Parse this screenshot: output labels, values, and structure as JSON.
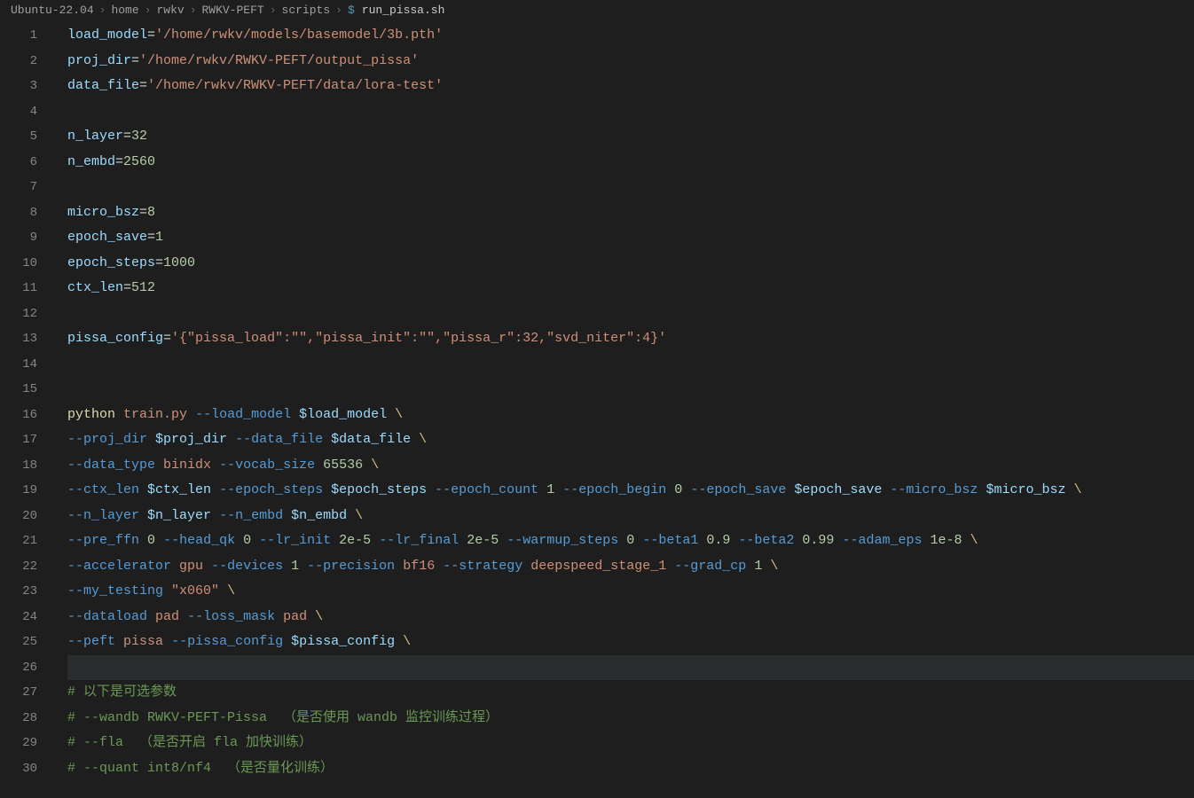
{
  "breadcrumb": {
    "items": [
      "Ubuntu-22.04",
      "home",
      "rwkv",
      "RWKV-PEFT",
      "scripts"
    ],
    "icon": "$",
    "file": "run_pissa.sh"
  },
  "code": {
    "lines": [
      {
        "n": 1,
        "tokens": [
          {
            "c": "var",
            "t": "load_model"
          },
          {
            "c": "op",
            "t": "="
          },
          {
            "c": "str",
            "t": "'/home/rwkv/models/basemodel/3b.pth'"
          }
        ]
      },
      {
        "n": 2,
        "tokens": [
          {
            "c": "var",
            "t": "proj_dir"
          },
          {
            "c": "op",
            "t": "="
          },
          {
            "c": "str",
            "t": "'/home/rwkv/RWKV-PEFT/output_pissa'"
          }
        ]
      },
      {
        "n": 3,
        "tokens": [
          {
            "c": "var",
            "t": "data_file"
          },
          {
            "c": "op",
            "t": "="
          },
          {
            "c": "str",
            "t": "'/home/rwkv/RWKV-PEFT/data/lora-test'"
          }
        ]
      },
      {
        "n": 4,
        "tokens": []
      },
      {
        "n": 5,
        "tokens": [
          {
            "c": "var",
            "t": "n_layer"
          },
          {
            "c": "op",
            "t": "="
          },
          {
            "c": "num-lit",
            "t": "32"
          }
        ]
      },
      {
        "n": 6,
        "tokens": [
          {
            "c": "var",
            "t": "n_embd"
          },
          {
            "c": "op",
            "t": "="
          },
          {
            "c": "num-lit",
            "t": "2560"
          }
        ]
      },
      {
        "n": 7,
        "tokens": []
      },
      {
        "n": 8,
        "tokens": [
          {
            "c": "var",
            "t": "micro_bsz"
          },
          {
            "c": "op",
            "t": "="
          },
          {
            "c": "num-lit",
            "t": "8"
          }
        ]
      },
      {
        "n": 9,
        "tokens": [
          {
            "c": "var",
            "t": "epoch_save"
          },
          {
            "c": "op",
            "t": "="
          },
          {
            "c": "num-lit",
            "t": "1"
          }
        ]
      },
      {
        "n": 10,
        "tokens": [
          {
            "c": "var",
            "t": "epoch_steps"
          },
          {
            "c": "op",
            "t": "="
          },
          {
            "c": "num-lit",
            "t": "1000"
          }
        ]
      },
      {
        "n": 11,
        "tokens": [
          {
            "c": "var",
            "t": "ctx_len"
          },
          {
            "c": "op",
            "t": "="
          },
          {
            "c": "num-lit",
            "t": "512"
          }
        ]
      },
      {
        "n": 12,
        "tokens": []
      },
      {
        "n": 13,
        "tokens": [
          {
            "c": "var",
            "t": "pissa_config"
          },
          {
            "c": "op",
            "t": "="
          },
          {
            "c": "str",
            "t": "'{\"pissa_load\":\"\",\"pissa_init\":\"\",\"pissa_r\":32,\"svd_niter\":4}'"
          }
        ]
      },
      {
        "n": 14,
        "tokens": []
      },
      {
        "n": 15,
        "tokens": []
      },
      {
        "n": 16,
        "tokens": [
          {
            "c": "cmd",
            "t": "python"
          },
          {
            "c": "op",
            "t": " "
          },
          {
            "c": "arg",
            "t": "train.py"
          },
          {
            "c": "op",
            "t": " "
          },
          {
            "c": "flag",
            "t": "--load_model"
          },
          {
            "c": "op",
            "t": " "
          },
          {
            "c": "dollar",
            "t": "$load_model"
          },
          {
            "c": "op",
            "t": " "
          },
          {
            "c": "esc",
            "t": "\\"
          }
        ]
      },
      {
        "n": 17,
        "tokens": [
          {
            "c": "flag",
            "t": "--proj_dir"
          },
          {
            "c": "op",
            "t": " "
          },
          {
            "c": "dollar",
            "t": "$proj_dir"
          },
          {
            "c": "op",
            "t": " "
          },
          {
            "c": "flag",
            "t": "--data_file"
          },
          {
            "c": "op",
            "t": " "
          },
          {
            "c": "dollar",
            "t": "$data_file"
          },
          {
            "c": "op",
            "t": " "
          },
          {
            "c": "esc",
            "t": "\\"
          }
        ]
      },
      {
        "n": 18,
        "tokens": [
          {
            "c": "flag",
            "t": "--data_type"
          },
          {
            "c": "op",
            "t": " "
          },
          {
            "c": "arg",
            "t": "binidx"
          },
          {
            "c": "op",
            "t": " "
          },
          {
            "c": "flag",
            "t": "--vocab_size"
          },
          {
            "c": "op",
            "t": " "
          },
          {
            "c": "num-lit",
            "t": "65536"
          },
          {
            "c": "op",
            "t": " "
          },
          {
            "c": "esc",
            "t": "\\"
          }
        ]
      },
      {
        "n": 19,
        "tokens": [
          {
            "c": "flag",
            "t": "--ctx_len"
          },
          {
            "c": "op",
            "t": " "
          },
          {
            "c": "dollar",
            "t": "$ctx_len"
          },
          {
            "c": "op",
            "t": " "
          },
          {
            "c": "flag",
            "t": "--epoch_steps"
          },
          {
            "c": "op",
            "t": " "
          },
          {
            "c": "dollar",
            "t": "$epoch_steps"
          },
          {
            "c": "op",
            "t": " "
          },
          {
            "c": "flag",
            "t": "--epoch_count"
          },
          {
            "c": "op",
            "t": " "
          },
          {
            "c": "num-lit",
            "t": "1"
          },
          {
            "c": "op",
            "t": " "
          },
          {
            "c": "flag",
            "t": "--epoch_begin"
          },
          {
            "c": "op",
            "t": " "
          },
          {
            "c": "num-lit",
            "t": "0"
          },
          {
            "c": "op",
            "t": " "
          },
          {
            "c": "flag",
            "t": "--epoch_save"
          },
          {
            "c": "op",
            "t": " "
          },
          {
            "c": "dollar",
            "t": "$epoch_save"
          },
          {
            "c": "op",
            "t": " "
          },
          {
            "c": "flag",
            "t": "--micro_bsz"
          },
          {
            "c": "op",
            "t": " "
          },
          {
            "c": "dollar",
            "t": "$micro_bsz"
          },
          {
            "c": "op",
            "t": " "
          },
          {
            "c": "esc",
            "t": "\\"
          }
        ]
      },
      {
        "n": 20,
        "tokens": [
          {
            "c": "flag",
            "t": "--n_layer"
          },
          {
            "c": "op",
            "t": " "
          },
          {
            "c": "dollar",
            "t": "$n_layer"
          },
          {
            "c": "op",
            "t": " "
          },
          {
            "c": "flag",
            "t": "--n_embd"
          },
          {
            "c": "op",
            "t": " "
          },
          {
            "c": "dollar",
            "t": "$n_embd"
          },
          {
            "c": "op",
            "t": " "
          },
          {
            "c": "esc",
            "t": "\\"
          }
        ]
      },
      {
        "n": 21,
        "tokens": [
          {
            "c": "flag",
            "t": "--pre_ffn"
          },
          {
            "c": "op",
            "t": " "
          },
          {
            "c": "num-lit",
            "t": "0"
          },
          {
            "c": "op",
            "t": " "
          },
          {
            "c": "flag",
            "t": "--head_qk"
          },
          {
            "c": "op",
            "t": " "
          },
          {
            "c": "num-lit",
            "t": "0"
          },
          {
            "c": "op",
            "t": " "
          },
          {
            "c": "flag",
            "t": "--lr_init"
          },
          {
            "c": "op",
            "t": " "
          },
          {
            "c": "num-lit",
            "t": "2e-5"
          },
          {
            "c": "op",
            "t": " "
          },
          {
            "c": "flag",
            "t": "--lr_final"
          },
          {
            "c": "op",
            "t": " "
          },
          {
            "c": "num-lit",
            "t": "2e-5"
          },
          {
            "c": "op",
            "t": " "
          },
          {
            "c": "flag",
            "t": "--warmup_steps"
          },
          {
            "c": "op",
            "t": " "
          },
          {
            "c": "num-lit",
            "t": "0"
          },
          {
            "c": "op",
            "t": " "
          },
          {
            "c": "flag",
            "t": "--beta1"
          },
          {
            "c": "op",
            "t": " "
          },
          {
            "c": "num-lit",
            "t": "0.9"
          },
          {
            "c": "op",
            "t": " "
          },
          {
            "c": "flag",
            "t": "--beta2"
          },
          {
            "c": "op",
            "t": " "
          },
          {
            "c": "num-lit",
            "t": "0.99"
          },
          {
            "c": "op",
            "t": " "
          },
          {
            "c": "flag",
            "t": "--adam_eps"
          },
          {
            "c": "op",
            "t": " "
          },
          {
            "c": "num-lit",
            "t": "1e-8"
          },
          {
            "c": "op",
            "t": " "
          },
          {
            "c": "esc",
            "t": "\\"
          }
        ]
      },
      {
        "n": 22,
        "tokens": [
          {
            "c": "flag",
            "t": "--accelerator"
          },
          {
            "c": "op",
            "t": " "
          },
          {
            "c": "arg",
            "t": "gpu"
          },
          {
            "c": "op",
            "t": " "
          },
          {
            "c": "flag",
            "t": "--devices"
          },
          {
            "c": "op",
            "t": " "
          },
          {
            "c": "num-lit",
            "t": "1"
          },
          {
            "c": "op",
            "t": " "
          },
          {
            "c": "flag",
            "t": "--precision"
          },
          {
            "c": "op",
            "t": " "
          },
          {
            "c": "arg",
            "t": "bf16"
          },
          {
            "c": "op",
            "t": " "
          },
          {
            "c": "flag",
            "t": "--strategy"
          },
          {
            "c": "op",
            "t": " "
          },
          {
            "c": "arg",
            "t": "deepspeed_stage_1"
          },
          {
            "c": "op",
            "t": " "
          },
          {
            "c": "flag",
            "t": "--grad_cp"
          },
          {
            "c": "op",
            "t": " "
          },
          {
            "c": "num-lit",
            "t": "1"
          },
          {
            "c": "op",
            "t": " "
          },
          {
            "c": "esc",
            "t": "\\"
          }
        ]
      },
      {
        "n": 23,
        "tokens": [
          {
            "c": "flag",
            "t": "--my_testing"
          },
          {
            "c": "op",
            "t": " "
          },
          {
            "c": "str",
            "t": "\"x060\""
          },
          {
            "c": "op",
            "t": " "
          },
          {
            "c": "esc",
            "t": "\\"
          }
        ]
      },
      {
        "n": 24,
        "tokens": [
          {
            "c": "flag",
            "t": "--dataload"
          },
          {
            "c": "op",
            "t": " "
          },
          {
            "c": "arg",
            "t": "pad"
          },
          {
            "c": "op",
            "t": " "
          },
          {
            "c": "flag",
            "t": "--loss_mask"
          },
          {
            "c": "op",
            "t": " "
          },
          {
            "c": "arg",
            "t": "pad"
          },
          {
            "c": "op",
            "t": " "
          },
          {
            "c": "esc",
            "t": "\\"
          }
        ]
      },
      {
        "n": 25,
        "tokens": [
          {
            "c": "flag",
            "t": "--peft"
          },
          {
            "c": "op",
            "t": " "
          },
          {
            "c": "arg",
            "t": "pissa"
          },
          {
            "c": "op",
            "t": " "
          },
          {
            "c": "flag",
            "t": "--pissa_config"
          },
          {
            "c": "op",
            "t": " "
          },
          {
            "c": "dollar",
            "t": "$pissa_config"
          },
          {
            "c": "op",
            "t": " "
          },
          {
            "c": "esc",
            "t": "\\"
          }
        ]
      },
      {
        "n": 26,
        "tokens": [],
        "current": true
      },
      {
        "n": 27,
        "tokens": [
          {
            "c": "comment",
            "t": "# 以下是可选参数"
          }
        ]
      },
      {
        "n": 28,
        "tokens": [
          {
            "c": "comment",
            "t": "# --wandb RWKV-PEFT-Pissa  （是否使用 wandb 监控训练过程）"
          }
        ]
      },
      {
        "n": 29,
        "tokens": [
          {
            "c": "comment",
            "t": "# --fla  （是否开启 fla 加快训练）"
          }
        ]
      },
      {
        "n": 30,
        "tokens": [
          {
            "c": "comment",
            "t": "# --quant int8/nf4  （是否量化训练）"
          }
        ]
      }
    ]
  }
}
